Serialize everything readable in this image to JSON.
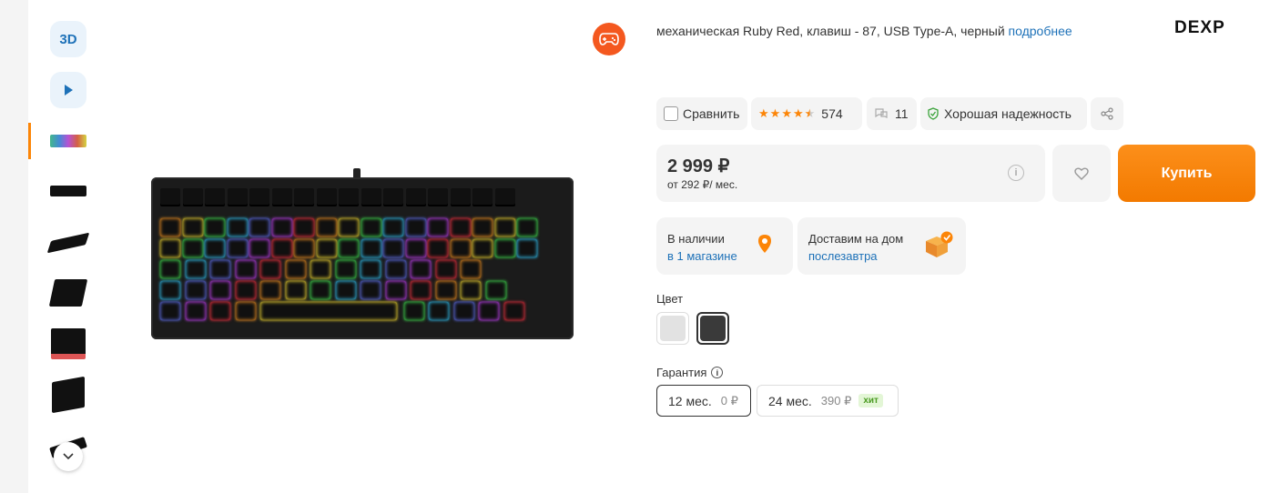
{
  "gallery": {
    "btn_3d": "3D",
    "thumbnails": [
      "keyboard-rgb-top",
      "keyboard-top",
      "keyboard-angle",
      "keyboard-angle-2",
      "keyboard-detail",
      "keyboard-keys",
      "keyboard-side"
    ]
  },
  "product": {
    "title": "механическая Ruby Red, клавиш - 87, USB Type-A, черный",
    "more_link": "подробнее",
    "brand": "DEXP"
  },
  "actions": {
    "compare_label": "Сравнить",
    "rating": 4.5,
    "reviews_count": "574",
    "questions_count": "11",
    "reliability_label": "Хорошая надежность"
  },
  "price": {
    "value": "2 999 ₽",
    "credit": "от 292 ₽/ мес.",
    "buy_label": "Купить"
  },
  "availability": {
    "stock_line1": "В наличии",
    "stock_line2": "в 1 магазине",
    "delivery_line1": "Доставим на дом",
    "delivery_line2": "послезавтра"
  },
  "color": {
    "label": "Цвет",
    "options": [
      {
        "name": "white",
        "hex": "#e2e2e2"
      },
      {
        "name": "black",
        "hex": "#3a3a3a"
      }
    ],
    "selected": "black"
  },
  "warranty": {
    "label": "Гарантия",
    "options": [
      {
        "term": "12 мес.",
        "price": "0 ₽"
      },
      {
        "term": "24 мес.",
        "price": "390 ₽",
        "badge": "хит"
      }
    ]
  },
  "colors": {
    "accent": "#fc8507",
    "link": "#1d71b8",
    "chip_bg": "#f4f4f4"
  }
}
